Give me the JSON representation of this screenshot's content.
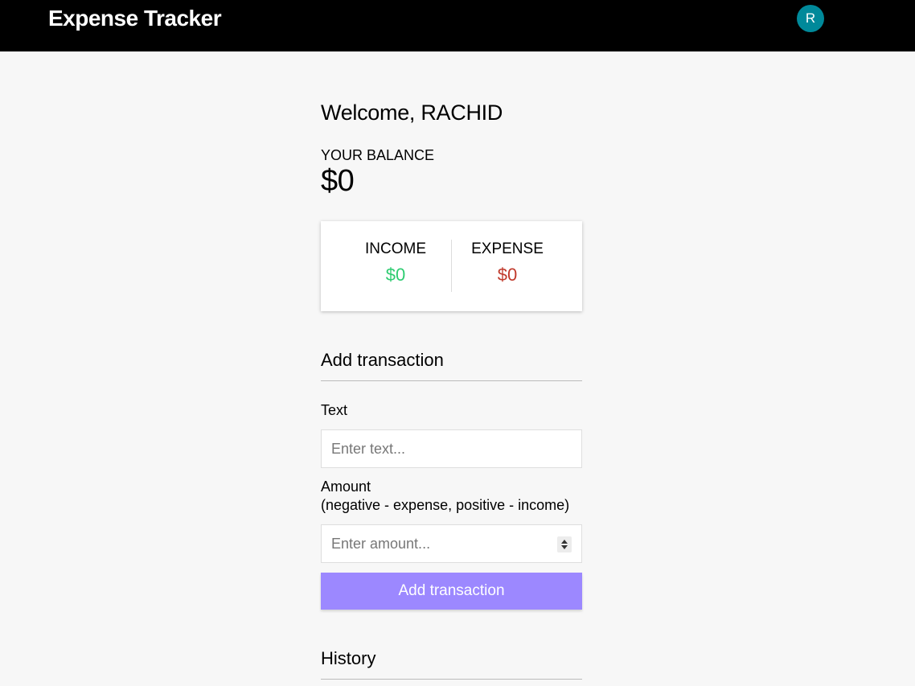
{
  "header": {
    "app_title": "Expense Tracker",
    "avatar_initial": "R"
  },
  "main": {
    "welcome": "Welcome, RACHID",
    "balance_label": "YOUR BALANCE",
    "balance_value": "$0",
    "income": {
      "label": "INCOME",
      "value": "$0"
    },
    "expense": {
      "label": "EXPENSE",
      "value": "$0"
    },
    "add_section_title": "Add transaction",
    "text_field": {
      "label": "Text",
      "placeholder": "Enter text...",
      "value": ""
    },
    "amount_field": {
      "label_line1": "Amount",
      "label_line2": "(negative - expense, positive - income)",
      "placeholder": "Enter amount...",
      "value": ""
    },
    "add_button_label": "Add transaction",
    "history_title": "History"
  },
  "colors": {
    "header_bg": "#000000",
    "avatar_bg": "#00899a",
    "income": "#2ecc71",
    "expense": "#c0392b",
    "button_bg": "#9c88ff",
    "page_bg": "#f7f7f7"
  }
}
